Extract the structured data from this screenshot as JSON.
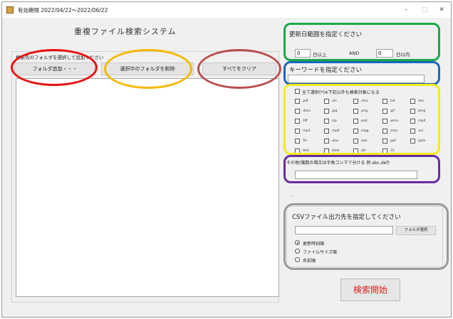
{
  "window": {
    "title": "有効期限  2022/04/22～2022/06/22",
    "minimize": "–",
    "maximize": "□",
    "close": "✕"
  },
  "left": {
    "title": "重複ファイル検索システム",
    "hint": "検索先のフォルダを選択して追加ください",
    "add_folder_button": "フォルダ追加・・・",
    "remove_folder_button": "選択中のフォルダを削除",
    "clear_all_button": "すべてをクリア"
  },
  "date_range": {
    "label": "更新日範囲を指定ください",
    "from_value": "0",
    "from_suffix": "日以上",
    "and_label": "AND",
    "to_value": "0",
    "to_suffix": "日以内"
  },
  "keyword": {
    "label": "キーワードを指定ください",
    "value": ""
  },
  "extensions": {
    "select_all_label": "全て選択(*)※下記以外も検索対象になる",
    "rows": [
      [
        ".pdf",
        ".xls",
        ".xlsx",
        ".txt",
        ".doc"
      ],
      [
        ".docx",
        ".jpg",
        ".png",
        ".gif",
        ".bmp"
      ],
      [
        ".tiff",
        ".zip",
        ".psd",
        ".wmv",
        ".mp4"
      ],
      [
        ".mp3",
        ".mp4",
        ".mpg",
        ".mov",
        ".avi"
      ],
      [
        ".flv",
        ".wav",
        ".exe",
        ".ppt",
        ".pptx"
      ],
      [
        ".htm",
        ".html",
        ".lzh",
        ".7z"
      ]
    ]
  },
  "other_ext": {
    "label": "その他(複数の場合は半角コンマで分ける 例 abc,def)",
    "value": ""
  },
  "misc_text": "...",
  "csv": {
    "label": "CSVファイル出力先を指定してください",
    "path_value": "",
    "select_folder_button": "フォルダ選択",
    "sort_options": [
      "更新時刻順",
      "ファイルサイズ順",
      "名前順"
    ]
  },
  "search_button": "検索開始",
  "highlights": {
    "red": "#e81010",
    "orange": "#f5b800",
    "brown": "#b8504e",
    "green": "#1aa84a",
    "blue": "#1b67b8",
    "yellow": "#f2ec1a",
    "purple": "#6a2aa0",
    "gray": "#9a9a9a"
  }
}
